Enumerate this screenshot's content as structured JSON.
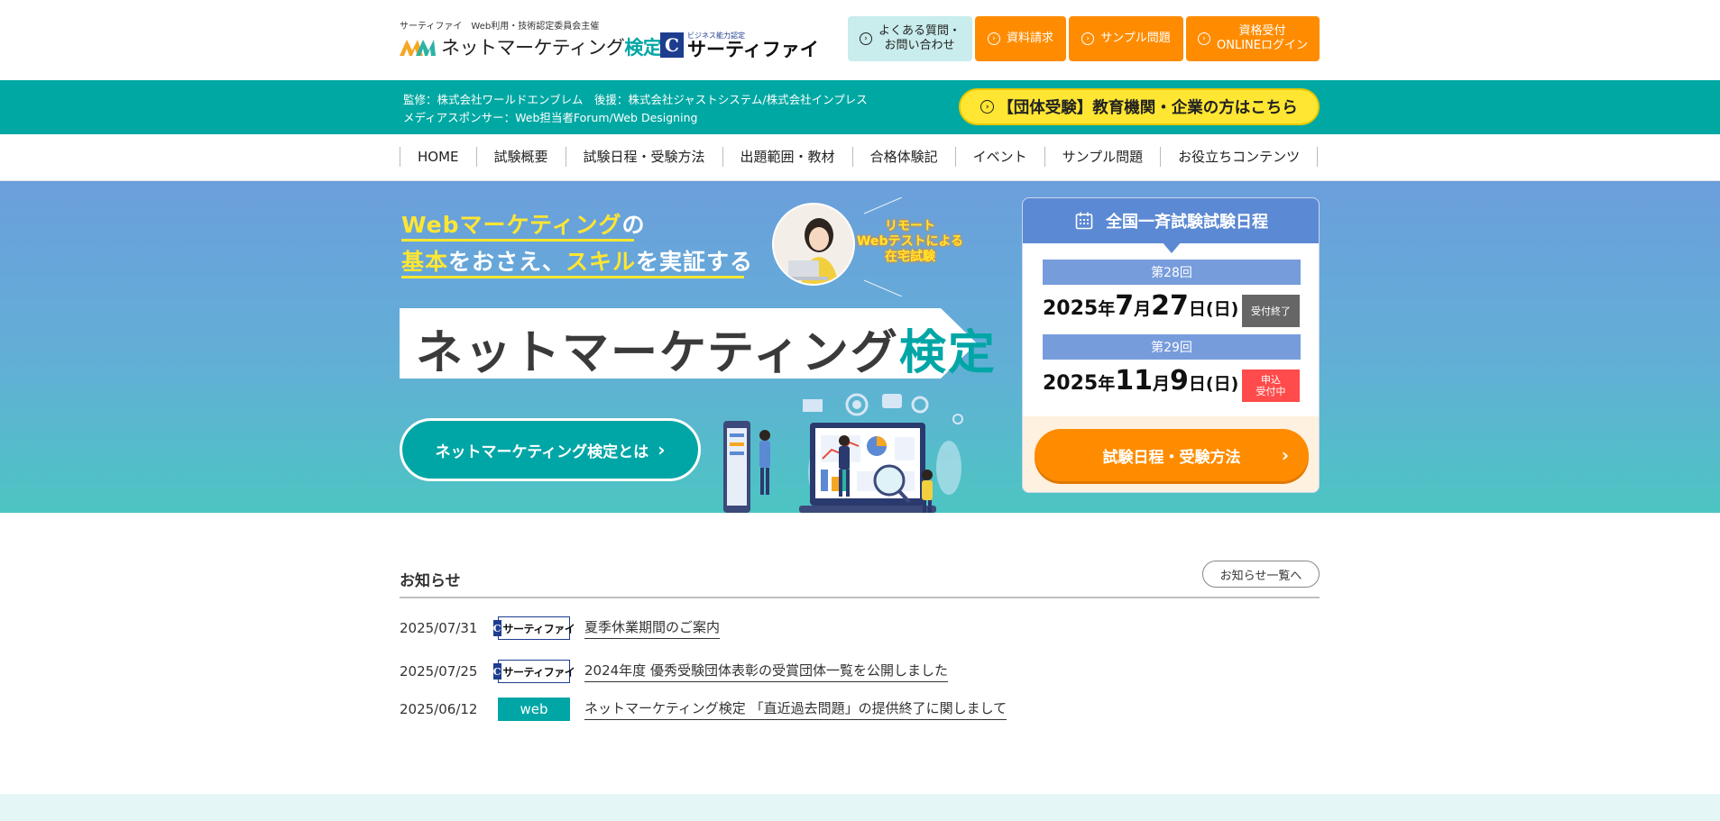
{
  "header": {
    "caption": "サーティファイ　Web利用・技術認定委員会主催",
    "logo_name": "ネットマーケティング",
    "logo_name_accent": "検定",
    "certy_small": "ビジネス能力認定",
    "certy_big": "サーティファイ",
    "certy_mark": "C",
    "buttons": [
      {
        "label_line1": "よくある質問・",
        "label_line2": "お問い合わせ"
      },
      {
        "label_line1": "資料請求",
        "label_line2": ""
      },
      {
        "label_line1": "サンプル問題",
        "label_line2": ""
      },
      {
        "label_line1": "資格受付",
        "label_line2": "ONLINEログイン"
      }
    ]
  },
  "band": {
    "sponsor_line1": "監修：株式会社ワールドエンブレム　後援：株式会社ジャストシステム/株式会社インプレス",
    "sponsor_line2": "メディアスポンサー：Web担当者Forum/Web Designing",
    "group_button": "【団体受験】教育機関・企業の方はこちら"
  },
  "nav": {
    "items": [
      "HOME",
      "試験概要",
      "試験日程・受験方法",
      "出題範囲・教材",
      "合格体験記",
      "イベント",
      "サンプル問題",
      "お役立ちコンテンツ"
    ]
  },
  "hero": {
    "tagline1_a": "Webマーケティング",
    "tagline1_b": "の",
    "tagline2_a": "基本",
    "tagline2_b": "をおさえ、",
    "tagline2_c": "スキル",
    "tagline2_d": "を実証する",
    "remote_line1": "リモート",
    "remote_line2": "Webテストによる",
    "remote_line3": "在宅試験",
    "title_main": "ネットマーケティング",
    "title_accent": "検定",
    "about_button": "ネットマーケティング検定とは",
    "arrow": "›"
  },
  "schedule": {
    "heading": "全国一斉試験試験日程",
    "rounds": [
      {
        "round": "第28回",
        "year": "2025",
        "year_unit": "年",
        "month": "7",
        "month_unit": "月",
        "day": "27",
        "day_unit": "日",
        "weekday": "(日)",
        "badge": "受付終了",
        "badge_line2": ""
      },
      {
        "round": "第29回",
        "year": "2025",
        "year_unit": "年",
        "month": "11",
        "month_unit": "月",
        "day": "9",
        "day_unit": "日",
        "weekday": "(日)",
        "badge": "申込",
        "badge_line2": "受付中"
      }
    ],
    "button": "試験日程・受験方法",
    "arrow": "›"
  },
  "news": {
    "title": "お知らせ",
    "all_button": "お知らせ一覧へ",
    "items": [
      {
        "date": "2025/07/31",
        "tag": "サーティファイ",
        "tag_type": "certy",
        "title": "夏季休業期間のご案内"
      },
      {
        "date": "2025/07/25",
        "tag": "サーティファイ",
        "tag_type": "certy",
        "title": "2024年度 優秀受験団体表彰の受賞団体一覧を公開しました"
      },
      {
        "date": "2025/06/12",
        "tag": "web",
        "tag_type": "web",
        "title": "ネットマーケティング検定 「直近過去問題」の提供終了に関しまして"
      }
    ]
  },
  "colors": {
    "teal": "#00a6a6",
    "orange": "#ff8c00",
    "yellow": "#ffe632",
    "blue": "#5c89d3"
  },
  "icons": {
    "header_button_icon": "circle-chevron-icon",
    "schedule_icon": "calendar-icon"
  }
}
